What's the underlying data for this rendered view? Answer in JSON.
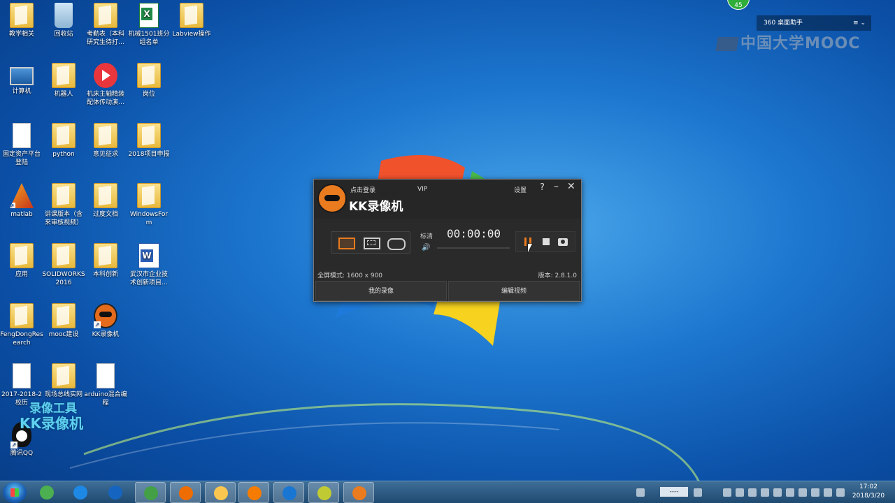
{
  "desktop": {
    "icons": [
      {
        "label": "教学相关",
        "kind": "folder"
      },
      {
        "label": "回收站",
        "kind": "recycle-bin"
      },
      {
        "label": "考勤表（本科研究生待打…",
        "kind": "folder"
      },
      {
        "label": "机械1501班分组名单",
        "kind": "excel"
      },
      {
        "label": "Labview操作",
        "kind": "folder"
      },
      {
        "label": "计算机",
        "kind": "computer"
      },
      {
        "label": "机器人",
        "kind": "folder"
      },
      {
        "label": "机床主轴精装配体传动演…",
        "kind": "video"
      },
      {
        "label": "岗位",
        "kind": "folder"
      },
      {
        "label": "固定资产平台登陆",
        "kind": "document"
      },
      {
        "label": "python",
        "kind": "folder"
      },
      {
        "label": "意见征求",
        "kind": "folder"
      },
      {
        "label": "2018项目申报",
        "kind": "folder"
      },
      {
        "label": "matlab",
        "kind": "matlab"
      },
      {
        "label": "讲课版本（含来审核视频）",
        "kind": "folder"
      },
      {
        "label": "过度文档",
        "kind": "folder"
      },
      {
        "label": "WindowsForm",
        "kind": "folder"
      },
      {
        "label": "应用",
        "kind": "folder"
      },
      {
        "label": "SOLIDWORKS 2016",
        "kind": "folder"
      },
      {
        "label": "本科创新",
        "kind": "folder"
      },
      {
        "label": "武汉市企业技术创新项目…",
        "kind": "word"
      },
      {
        "label": "FengDongResearch",
        "kind": "folder"
      },
      {
        "label": "mooc建设",
        "kind": "folder"
      },
      {
        "label": "KK录像机",
        "kind": "kk"
      },
      {
        "label": "2017-2018-2校历",
        "kind": "document"
      },
      {
        "label": "现场总线实网",
        "kind": "folder"
      },
      {
        "label": "arduino混合编程",
        "kind": "document"
      },
      {
        "label": "腾讯QQ",
        "kind": "qq"
      }
    ],
    "watermark_line1": "录像工具",
    "watermark_line2": "KK录像机"
  },
  "top_right": {
    "badge": "45",
    "assistant_label": "360 桌面助手",
    "assistant_menu": "≡ ⌄",
    "mooc_logo": "中国大学MOOC"
  },
  "kk_window": {
    "login": "点击登录",
    "vip": "VIP",
    "title": "KK录像机",
    "settings": "设置",
    "help": "?",
    "minimize": "–",
    "close": "✕",
    "quality": "标清",
    "volume_icon": "🔊",
    "timer": "00:00:00",
    "fullscreen_mode": "全屏模式: 1600 x 900",
    "version": "版本: 2.8.1.0",
    "my_recordings": "我的录像",
    "edit_video": "编辑视频",
    "modes": [
      "screen-mode-icon",
      "region-mode-icon",
      "game-mode-icon"
    ],
    "accent_color": "#ea7b1f"
  },
  "taskbar": {
    "apps": [
      {
        "name": "360-icon",
        "color": "#4caf50"
      },
      {
        "name": "ie-blue-icon",
        "color": "#1e88e5"
      },
      {
        "name": "ie-icon",
        "color": "#1565c0"
      },
      {
        "name": "browser-green-icon",
        "color": "#43a047"
      },
      {
        "name": "firefox-icon",
        "color": "#ef6c00"
      },
      {
        "name": "explorer-icon",
        "color": "#f9c74f"
      },
      {
        "name": "media-player-icon",
        "color": "#f57c00"
      },
      {
        "name": "sogou-icon",
        "color": "#1976d2"
      },
      {
        "name": "video-editor-icon",
        "color": "#c0ca33"
      },
      {
        "name": "kk-recorder-icon",
        "color": "#ea7b1f"
      }
    ],
    "keyboard": "----",
    "time": "17:02",
    "date": "2018/3/20"
  }
}
